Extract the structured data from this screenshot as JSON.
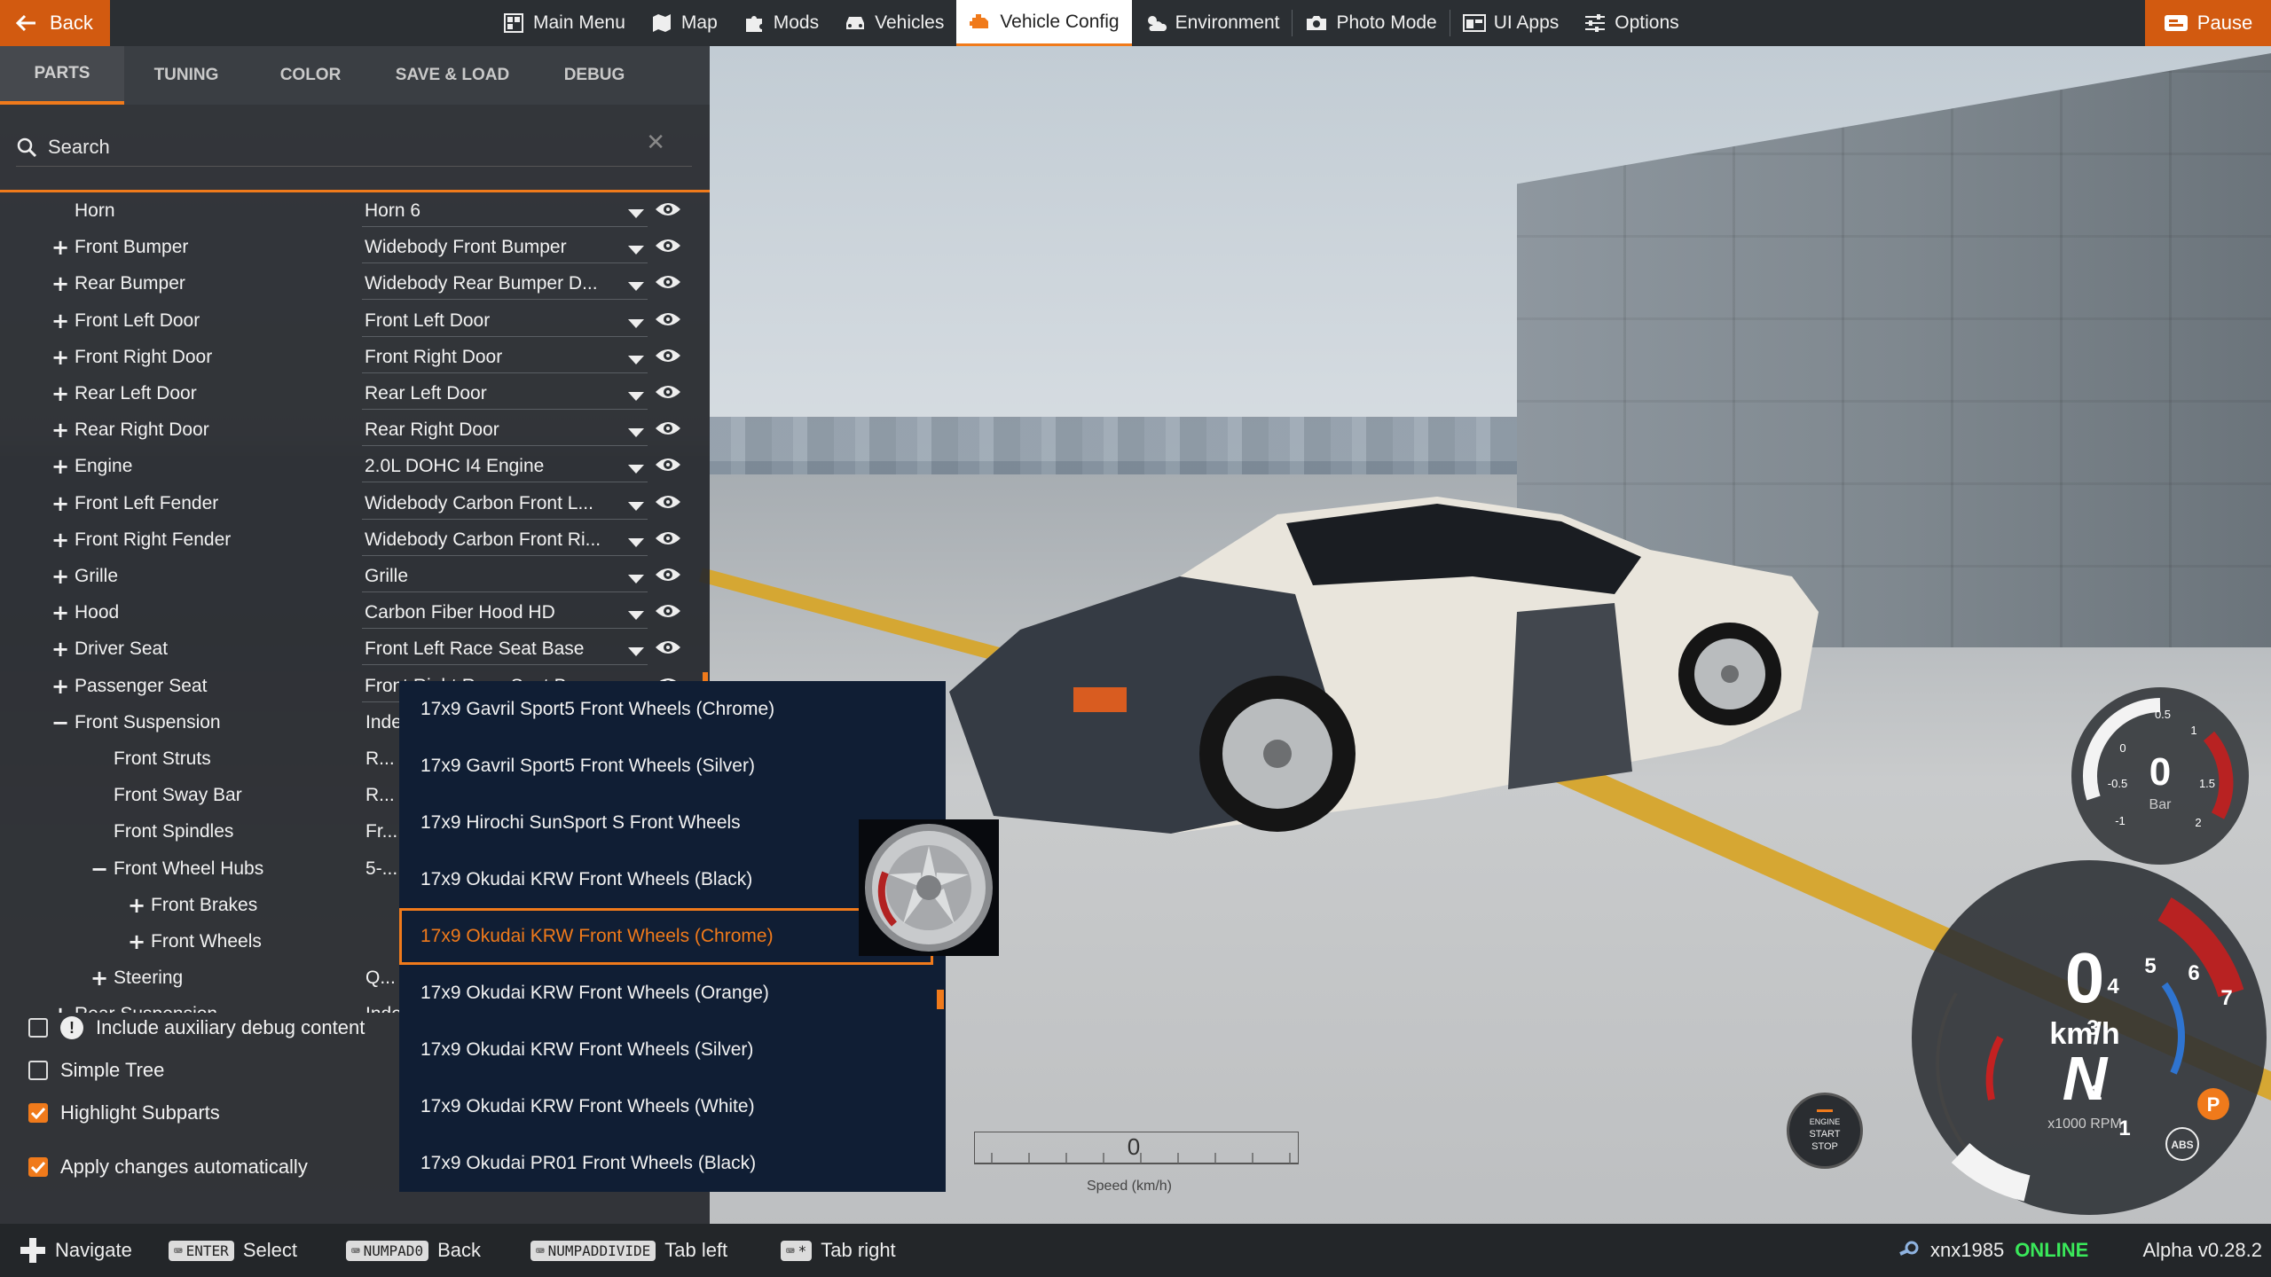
{
  "topbar": {
    "back_label": "Back",
    "nav": [
      {
        "label": "Main Menu",
        "icon": "grid-icon"
      },
      {
        "label": "Map",
        "icon": "map-icon"
      },
      {
        "label": "Mods",
        "icon": "puzzle-icon"
      },
      {
        "label": "Vehicles",
        "icon": "car-icon"
      },
      {
        "label": "Vehicle Config",
        "icon": "engine-icon",
        "active": true
      },
      {
        "label": "Environment",
        "icon": "weather-icon"
      },
      {
        "label": "Photo Mode",
        "icon": "camera-icon"
      },
      {
        "label": "UI Apps",
        "icon": "ui-apps-icon"
      },
      {
        "label": "Options",
        "icon": "sliders-icon"
      }
    ],
    "pause_label": "Pause"
  },
  "tabs": [
    "PARTS",
    "TUNING",
    "COLOR",
    "SAVE & LOAD",
    "DEBUG"
  ],
  "search": {
    "placeholder": "Search"
  },
  "parts": [
    {
      "label": "Horn",
      "value": "Horn 6",
      "toggle": "",
      "indent": 0
    },
    {
      "label": "Front Bumper",
      "value": "Widebody Front Bumper",
      "toggle": "+",
      "indent": 0
    },
    {
      "label": "Rear Bumper",
      "value": "Widebody Rear Bumper D...",
      "toggle": "+",
      "indent": 0
    },
    {
      "label": "Front Left Door",
      "value": "Front Left Door",
      "toggle": "+",
      "indent": 0
    },
    {
      "label": "Front Right Door",
      "value": "Front Right Door",
      "toggle": "+",
      "indent": 0
    },
    {
      "label": "Rear Left Door",
      "value": "Rear Left Door",
      "toggle": "+",
      "indent": 0
    },
    {
      "label": "Rear Right Door",
      "value": "Rear Right Door",
      "toggle": "+",
      "indent": 0
    },
    {
      "label": "Engine",
      "value": "2.0L DOHC I4 Engine",
      "toggle": "+",
      "indent": 0
    },
    {
      "label": "Front Left Fender",
      "value": "Widebody Carbon Front L...",
      "toggle": "+",
      "indent": 0
    },
    {
      "label": "Front Right Fender",
      "value": "Widebody Carbon Front Ri...",
      "toggle": "+",
      "indent": 0
    },
    {
      "label": "Grille",
      "value": "Grille",
      "toggle": "+",
      "indent": 0
    },
    {
      "label": "Hood",
      "value": "Carbon Fiber Hood HD",
      "toggle": "+",
      "indent": 0
    },
    {
      "label": "Driver Seat",
      "value": "Front Left Race Seat Base",
      "toggle": "+",
      "indent": 0
    },
    {
      "label": "Passenger Seat",
      "value": "Front Right Race Seat B...",
      "toggle": "+",
      "indent": 0
    },
    {
      "label": "Front Suspension",
      "value": "Indep...",
      "toggle": "−",
      "indent": 0
    },
    {
      "label": "Front Struts",
      "value": "R...",
      "toggle": "",
      "indent": 1
    },
    {
      "label": "Front Sway Bar",
      "value": "R...",
      "toggle": "",
      "indent": 1
    },
    {
      "label": "Front Spindles",
      "value": "Fr...",
      "toggle": "",
      "indent": 1
    },
    {
      "label": "Front Wheel Hubs",
      "value": "5-...",
      "toggle": "−",
      "indent": 1
    },
    {
      "label": "Front Brakes",
      "value": "",
      "toggle": "+",
      "indent": 2
    },
    {
      "label": "Front Wheels",
      "value": "",
      "toggle": "+",
      "indent": 2
    },
    {
      "label": "Steering",
      "value": "Q...",
      "toggle": "+",
      "indent": 1
    },
    {
      "label": "Rear Suspension",
      "value": "Inde...",
      "toggle": "+",
      "indent": 0
    }
  ],
  "options": [
    {
      "label": "Include auxiliary debug content",
      "checked": false,
      "info": true
    },
    {
      "label": "Simple Tree",
      "checked": false
    },
    {
      "label": "Highlight Subparts",
      "checked": true
    },
    {
      "label": "Apply changes automatically",
      "checked": true
    }
  ],
  "dropdown": {
    "items": [
      "17x9 Gavril Sport5 Front Wheels (Chrome)",
      "17x9 Gavril Sport5 Front Wheels (Silver)",
      "17x9 Hirochi SunSport S Front Wheels",
      "17x9 Okudai KRW Front Wheels (Black)",
      "17x9 Okudai KRW Front Wheels (Chrome)",
      "17x9 Okudai KRW Front Wheels (Orange)",
      "17x9 Okudai KRW Front Wheels (Silver)",
      "17x9 Okudai KRW Front Wheels (White)",
      "17x9 Okudai PR01 Front Wheels (Black)"
    ],
    "selected_index": 4
  },
  "speed_scale": {
    "value": "0",
    "label": "Speed (km/h)"
  },
  "gauges": {
    "boost": {
      "value": "0",
      "unit": "Bar",
      "ticks": [
        "-1",
        "-0.5",
        "0",
        "0.5",
        "1",
        "1.5",
        "2"
      ]
    },
    "speedo": {
      "speed": "0",
      "speed_unit": "km/h",
      "gear": "N",
      "rpm_unit": "x1000 RPM",
      "ticks": [
        "1",
        "2",
        "3",
        "4",
        "5",
        "6",
        "7"
      ],
      "parking": "P",
      "abs": "ABS"
    },
    "start_stop": {
      "line1": "ENGINE",
      "line2": "START",
      "line3": "STOP"
    }
  },
  "bottombar": {
    "hints": [
      {
        "key": "",
        "label": "Navigate"
      },
      {
        "key": "ENTER",
        "label": "Select"
      },
      {
        "key": "NUMPAD0",
        "label": "Back"
      },
      {
        "key": "NUMPADDIVIDE",
        "label": "Tab left"
      },
      {
        "key": "*",
        "label": "Tab right"
      }
    ],
    "username": "xnx1985",
    "status": "ONLINE",
    "version": "Alpha v0.28.2"
  },
  "colors": {
    "accent": "#f07a1b",
    "online": "#3ae85a",
    "dropdown_bg": "#101e34"
  }
}
